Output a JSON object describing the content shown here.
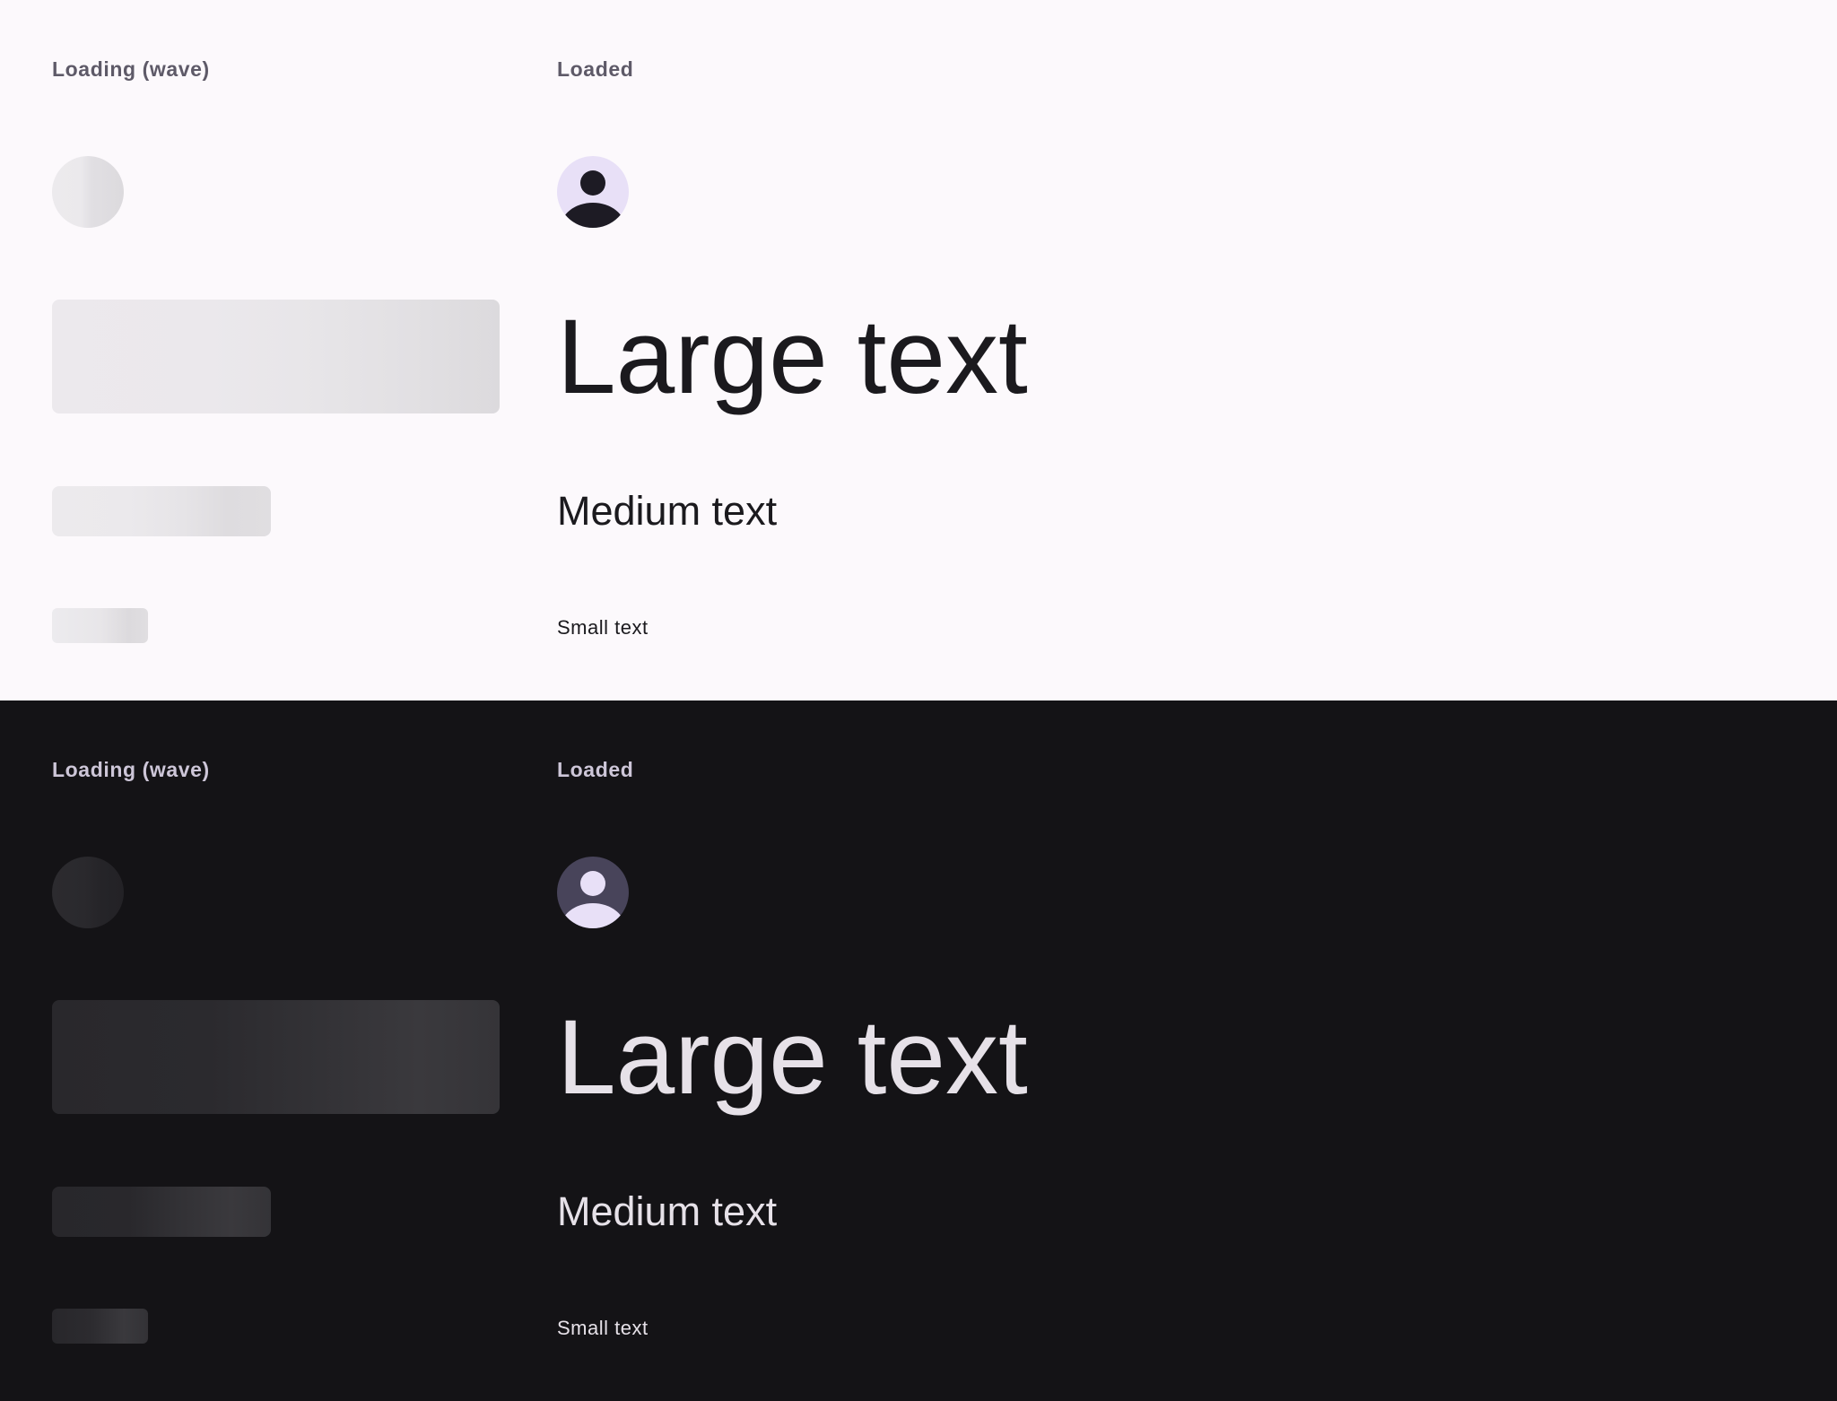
{
  "panels": {
    "light": {
      "loading_label": "Loading (wave)",
      "loaded_label": "Loaded",
      "large_text": "Large text",
      "medium_text": "Medium text",
      "small_text": "Small text",
      "colors": {
        "background": "#fcf9fc",
        "text": "#1b1a1e",
        "label": "#5e5a68",
        "avatar_bg": "#e8e0f7",
        "avatar_fg": "#1d1b24"
      }
    },
    "dark": {
      "loading_label": "Loading (wave)",
      "loaded_label": "Loaded",
      "large_text": "Large text",
      "medium_text": "Medium text",
      "small_text": "Small text",
      "colors": {
        "background": "#141316",
        "text": "#e6e1e8",
        "label": "#cdc6d8",
        "avatar_bg": "#48445a",
        "avatar_fg": "#e8e0f7"
      }
    }
  },
  "icons": {
    "avatar": "person-icon"
  }
}
